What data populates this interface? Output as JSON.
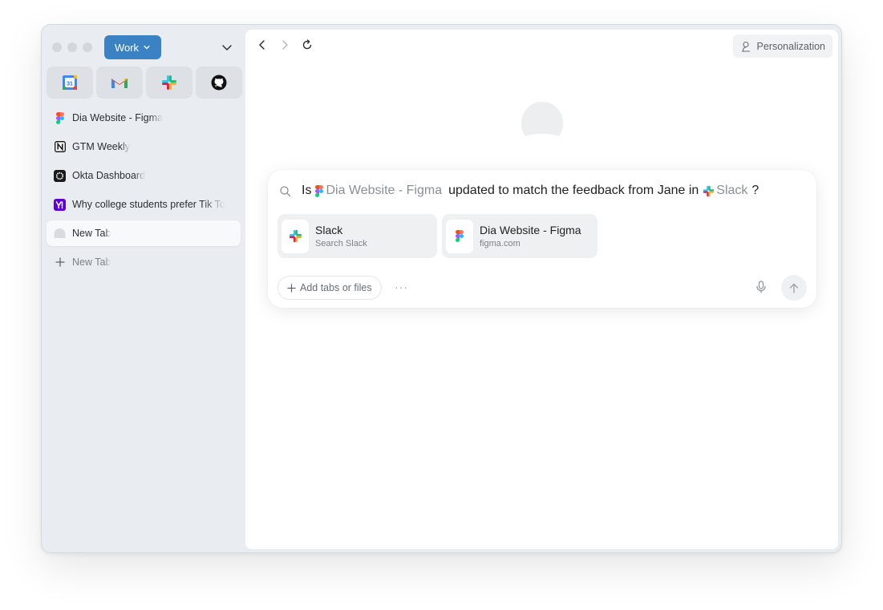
{
  "workspace": {
    "label": "Work"
  },
  "pinned_apps": [
    {
      "name": "google-calendar-icon",
      "text": "31"
    },
    {
      "name": "gmail-icon"
    },
    {
      "name": "slack-icon"
    },
    {
      "name": "github-icon"
    }
  ],
  "tabs": [
    {
      "label": "Dia Website - Figma",
      "icon": "figma-icon"
    },
    {
      "label": "GTM Weekly",
      "icon": "notion-icon"
    },
    {
      "label": "Okta Dashboard",
      "icon": "okta-icon"
    },
    {
      "label": "Why college students prefer Tik To",
      "icon": "yahoo-icon"
    },
    {
      "label": "New Tab",
      "icon": "dia-icon"
    }
  ],
  "new_tab_button": {
    "label": "New Tab"
  },
  "toolbar": {
    "personalization_label": "Personalization"
  },
  "query": {
    "part1": "Is",
    "ref1": "Dia Website - Figma",
    "part2": "updated to match the feedback from Jane in",
    "ref2": "Slack",
    "part3": "?"
  },
  "suggestions": [
    {
      "title": "Slack",
      "subtitle": "Search Slack",
      "icon": "slack-icon"
    },
    {
      "title": "Dia Website - Figma",
      "subtitle": "figma.com",
      "icon": "figma-icon"
    }
  ],
  "composer": {
    "add_label": "Add tabs or files",
    "more_label": "···"
  },
  "colors": {
    "accent": "#3b82c4",
    "sidebar_bg": "#e9edf1"
  }
}
